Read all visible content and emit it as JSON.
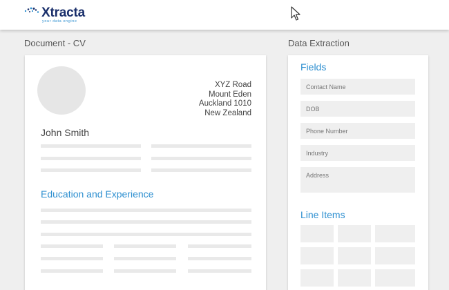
{
  "header": {
    "logo_name": "Xtracta",
    "logo_tagline": "your data engine",
    "accent": "#2d8fd0",
    "brand": "#1a2f6b"
  },
  "document": {
    "section_title": "Document - CV",
    "address": [
      "XYZ Road",
      "Mount Eden",
      "Auckland 1010",
      "New Zealand"
    ],
    "name": "John Smith",
    "education_heading": "Education and Experience"
  },
  "extraction": {
    "section_title": "Data Extraction",
    "fields_heading": "Fields",
    "fields": [
      "Contact Name",
      "DOB",
      "Phone Number",
      "Industry",
      "Address"
    ],
    "line_items_heading": "Line Items"
  },
  "icons": {
    "logo": "xtracta-dots-logo",
    "cursor": "mouse-pointer-icon"
  }
}
